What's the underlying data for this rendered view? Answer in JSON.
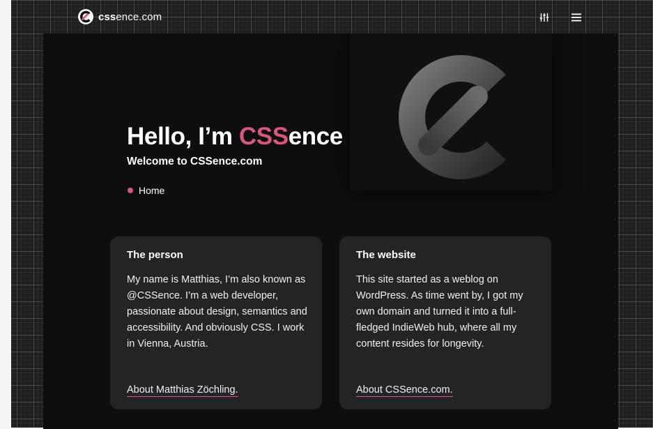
{
  "header": {
    "logo_bold": "css",
    "logo_rest": "ence.com",
    "settings_icon": "sliders-icon",
    "menu_icon": "hamburger-menu-icon"
  },
  "hero": {
    "title_prefix": "Hello, I’m ",
    "title_accent_1": "CSS",
    "title_suffix": "ence",
    "subtitle": "Welcome to CSSence.com",
    "breadcrumb": "Home"
  },
  "cards": {
    "person": {
      "title": "The person",
      "body": "My name is Matthias, I’m also known as @CSSence. I’m a web developer, passionate about design, semantics and accessibility. And obviously CSS. I work in Vienna, Austria.",
      "link": "About Matthias Zöchling."
    },
    "website": {
      "title": "The website",
      "body": "This site started as a weblog on WordPress. As time went by, I got my own domain and turned it into a full-fledged IndieWeb hub, where all my content resides for longevity.",
      "link": "About CSSence.com."
    }
  },
  "colors": {
    "accent": "#d6587a",
    "panel": "#0e0e10",
    "card": "#242428"
  }
}
